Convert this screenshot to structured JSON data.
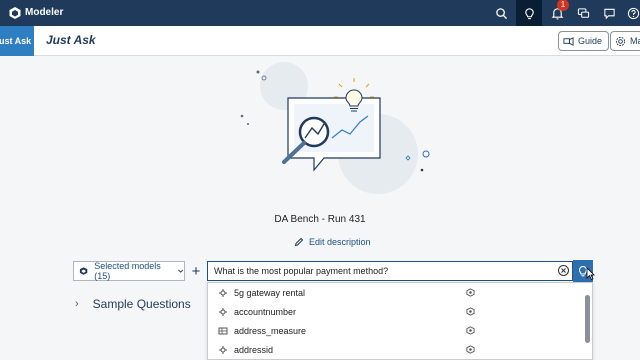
{
  "shell": {
    "app_title": "Modeler",
    "notification_count": "1"
  },
  "header": {
    "crumb_tab": "Just Ask",
    "page_title": "Just Ask",
    "guide_label": "Guide",
    "manage_label": "Ma"
  },
  "main": {
    "dataset_title": "DA Bench - Run 431",
    "edit_description": "Edit description"
  },
  "query": {
    "models_label": "Selected models (15)",
    "add_label": "+",
    "input_value": "What is the most popular payment method?"
  },
  "sample_questions": {
    "label": "Sample Questions"
  },
  "dropdown": {
    "items": [
      {
        "label": "5g gateway rental",
        "icon": "dimension-icon"
      },
      {
        "label": "accountnumber",
        "icon": "dimension-icon"
      },
      {
        "label": "address_measure",
        "icon": "measure-icon"
      },
      {
        "label": "addressid",
        "icon": "dimension-icon"
      }
    ]
  },
  "colors": {
    "shellbar": "#1f3a5a",
    "accent": "#2e7fc2",
    "link": "#1f4f80"
  }
}
